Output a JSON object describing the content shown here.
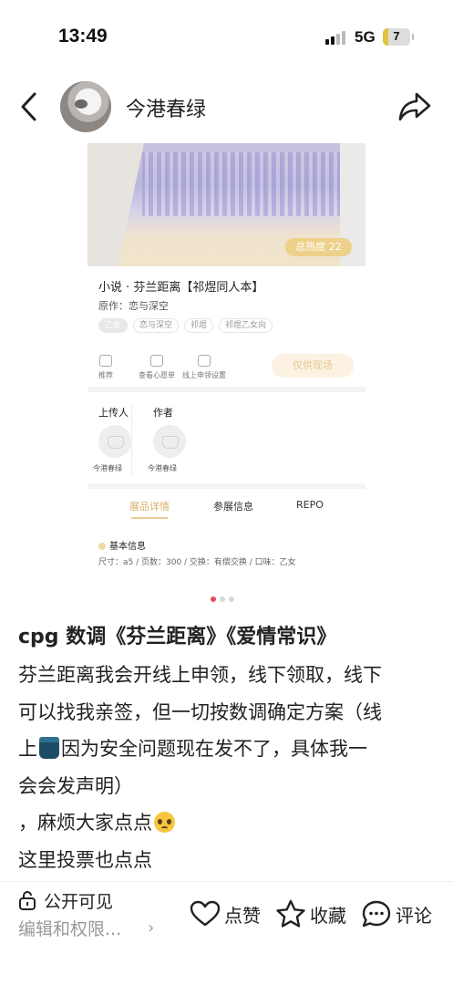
{
  "status_bar": {
    "time": "13:49",
    "network": "5G",
    "battery": "7"
  },
  "header": {
    "author_name": "今港春绿"
  },
  "card": {
    "hot_badge": "总热度 22",
    "title": "小说 · 芬兰距离【祁煜同人本】",
    "origin": "原作：恋与深空",
    "tags": [
      "乙女",
      "恋与深空",
      "祁煜",
      "祁煜乙女向"
    ],
    "actions": [
      "推荐",
      "查看心愿单",
      "线上申领设置"
    ],
    "exhibit_button": "仅供现场",
    "uploader_label": "上传人",
    "author_label": "作者",
    "uploader_name": "今港春绿",
    "author_name": "今港春绿",
    "tabs": [
      "展品详情",
      "参展信息",
      "REPO"
    ],
    "basic_info_title": "基本信息",
    "basic_info": "尺寸：a5  /  页数：300  /  交换：有偿交换  /  口味：乙女"
  },
  "pagination": {
    "count": 3,
    "active": 0
  },
  "post": {
    "title": "cpg 数调《芬兰距离》《爱情常识》",
    "lines": [
      "芬兰距离我会开线上申领，线下领取，线下",
      "可以找我亲签，但一切按数调确定方案（线",
      "因为安全问题现在发不了，具体我一",
      "会会发声明）",
      "，麻烦大家点点",
      "这里投票也点点"
    ],
    "line3_prefix": "上"
  },
  "bottom_bar": {
    "visibility": "公开可见",
    "edit_permission": "编辑和权限...",
    "like": "点赞",
    "collect": "收藏",
    "comment": "评论"
  }
}
